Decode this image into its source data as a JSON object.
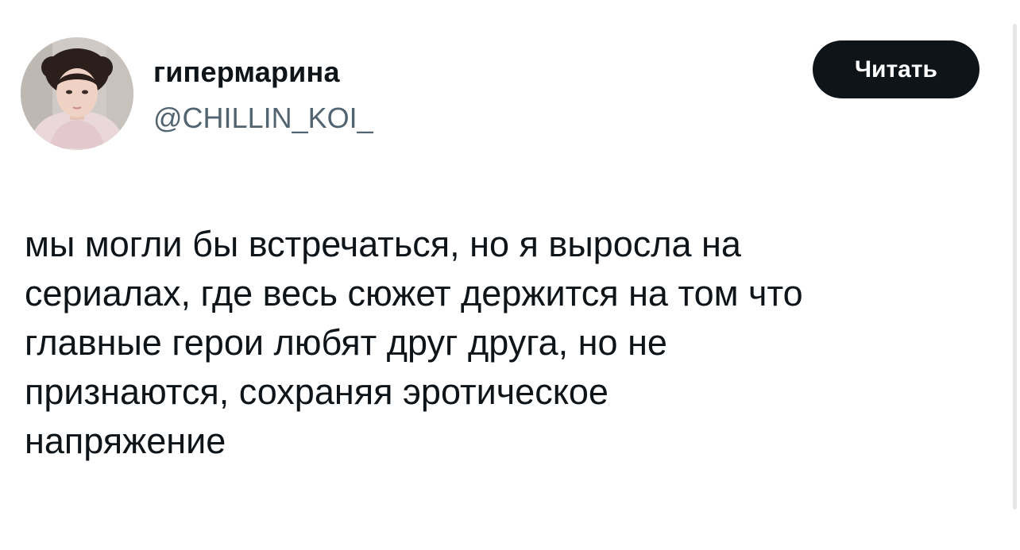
{
  "author": {
    "display_name": "гипермарина",
    "handle": "@CHILLIN_KOI_",
    "avatar_icon": "profile-photo"
  },
  "follow_button": {
    "label": "Читать"
  },
  "tweet": {
    "text": "мы могли бы встречаться, но я выросла на\nсериалах, где весь сюжет держится на том что\nглавные герои любят друг друга, но не\nпризнаются, сохраняя эротическое\nнапряжение"
  },
  "colors": {
    "text_primary": "#0f1419",
    "text_secondary": "#536471",
    "button_bg": "#0f1419",
    "button_text": "#ffffff",
    "background": "#ffffff"
  }
}
